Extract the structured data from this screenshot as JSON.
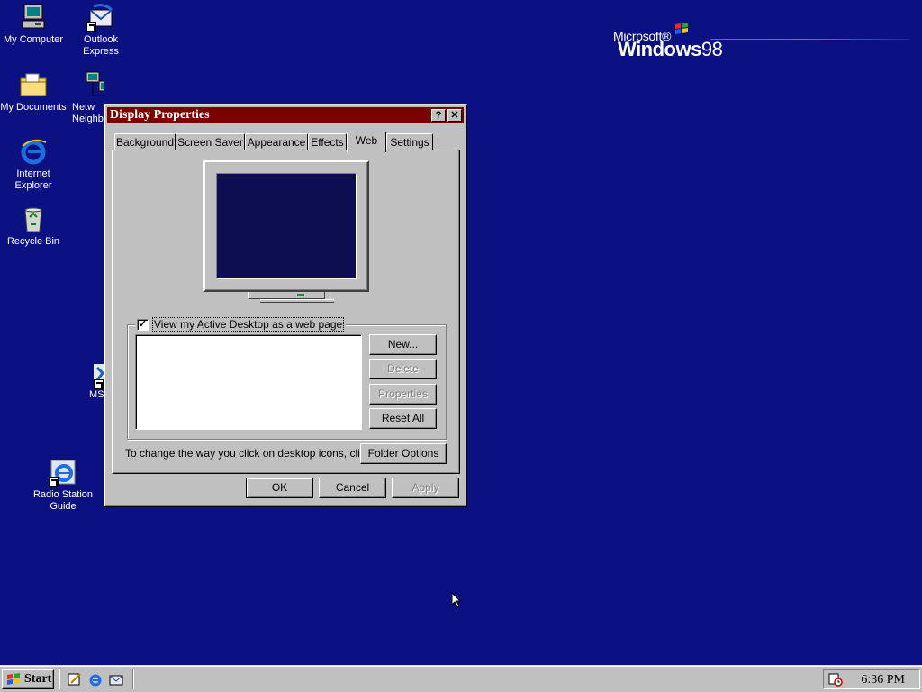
{
  "desktop": {
    "background_color": "#0c1182",
    "icons": [
      {
        "label": "My Computer",
        "icon": "computer-icon"
      },
      {
        "label": "Outlook Express",
        "icon": "outlook-express-icon"
      },
      {
        "label": "My Documents",
        "icon": "folder-icon"
      },
      {
        "label": "Netw Neighb",
        "icon": "network-neighborhood-icon"
      },
      {
        "label": "Internet Explorer",
        "icon": "internet-explorer-icon"
      },
      {
        "label": "Recycle Bin",
        "icon": "recycle-bin-icon"
      },
      {
        "label": "MS",
        "icon": "msn-icon"
      },
      {
        "label": "Radio Station Guide",
        "icon": "radio-station-guide-icon"
      }
    ],
    "logo": {
      "microsoft": "Microsoft®",
      "windows": "Windows",
      "version": "98"
    }
  },
  "dialog": {
    "title": "Display Properties",
    "title_color": "#7b0000",
    "help_label": "?",
    "close_label": "✕",
    "tabs": [
      "Background",
      "Screen Saver",
      "Appearance",
      "Effects",
      "Web",
      "Settings"
    ],
    "active_tab": "Web",
    "web": {
      "active_desktop_checkbox": {
        "label": "View my Active Desktop as a web page",
        "checked": true,
        "mark": "✓"
      },
      "buttons": {
        "new": "New...",
        "delete": "Delete",
        "properties": "Properties",
        "reset_all": "Reset All",
        "folder_options": "Folder Options"
      },
      "click_text": "To change the way you click on desktop icons, click:"
    },
    "footer": {
      "ok": "OK",
      "cancel": "Cancel",
      "apply": "Apply"
    }
  },
  "taskbar": {
    "start_label": "Start",
    "quick_launch": [
      "desktop-edit-icon",
      "internet-explorer-icon",
      "outlook-express-icon"
    ],
    "clock": "6:36 PM"
  }
}
